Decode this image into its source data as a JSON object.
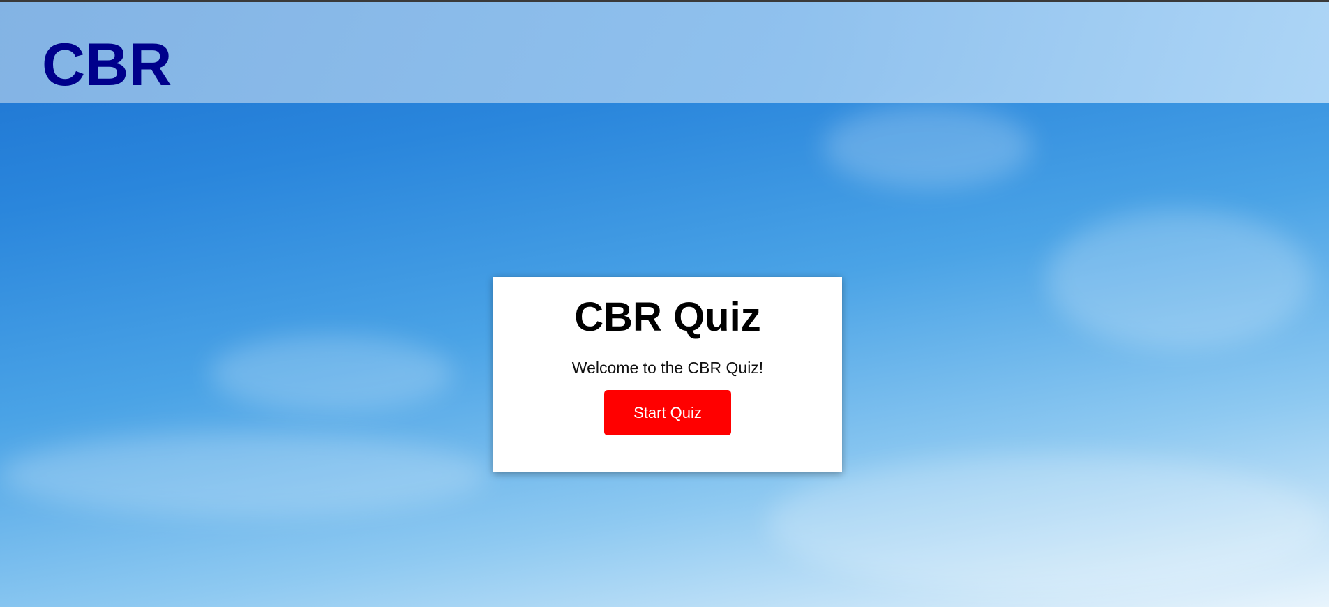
{
  "header": {
    "logo_text": "CBR"
  },
  "quiz_card": {
    "title": "CBR Quiz",
    "welcome_text": "Welcome to the CBR Quiz!",
    "start_button_label": "Start Quiz"
  },
  "colors": {
    "logo": "#00008b",
    "start_button": "#ff0000",
    "card_background": "#ffffff",
    "sky": "#2a86dc"
  }
}
